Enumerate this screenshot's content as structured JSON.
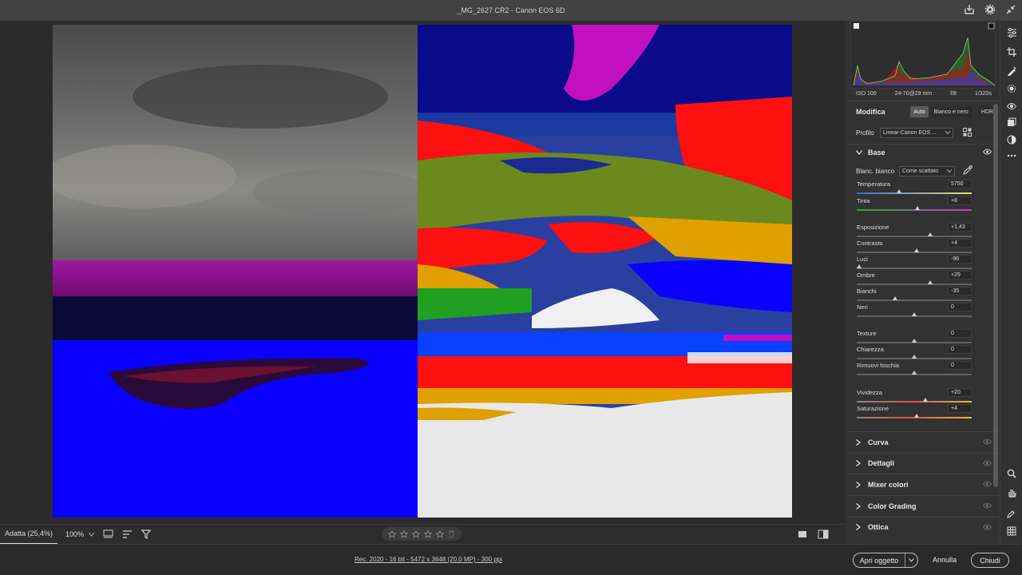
{
  "window": {
    "title": "_MG_2627.CR2  -  Canon EOS 6D"
  },
  "exif": {
    "iso": "ISO 100",
    "lens": "24-70@29 mm",
    "aperture": "f/8",
    "shutter": "1/320s"
  },
  "edit": {
    "title": "Modifica",
    "auto_label": "Auto",
    "bw_label": "Bianco e nero",
    "hdr_label": "HDR",
    "profile_label": "Profilo",
    "profile_value": "Linear-Canon EOS ..."
  },
  "base": {
    "title": "Base",
    "wb_label": "Blanc. bianco",
    "wb_value": "Come scattato",
    "sliders": [
      {
        "label": "Temperatura",
        "value": "5750",
        "pos": 0.37
      },
      {
        "label": "Tinta",
        "value": "+8",
        "pos": 0.53
      },
      {
        "label": "Esposizione",
        "value": "+1,43",
        "pos": 0.64
      },
      {
        "label": "Contrasto",
        "value": "+4",
        "pos": 0.52
      },
      {
        "label": "Luci",
        "value": "-96",
        "pos": 0.02
      },
      {
        "label": "Ombre",
        "value": "+29",
        "pos": 0.64
      },
      {
        "label": "Bianchi",
        "value": "-35",
        "pos": 0.33
      },
      {
        "label": "Neri",
        "value": "0",
        "pos": 0.5
      },
      {
        "label": "Texture",
        "value": "0",
        "pos": 0.5
      },
      {
        "label": "Chiarezza",
        "value": "0",
        "pos": 0.5
      },
      {
        "label": "Rimuovi foschia",
        "value": "0",
        "pos": 0.5
      },
      {
        "label": "Vividezza",
        "value": "+20",
        "pos": 0.6
      },
      {
        "label": "Saturazione",
        "value": "+4",
        "pos": 0.52
      }
    ]
  },
  "sections": [
    {
      "label": "Curva"
    },
    {
      "label": "Dettagli"
    },
    {
      "label": "Mixer colori"
    },
    {
      "label": "Color Grading"
    },
    {
      "label": "Ottica"
    }
  ],
  "toolbar": {
    "zoom_fit": "Adatta (25,4%)",
    "zoom_100": "100%"
  },
  "footer": {
    "info": "Rec. 2020 - 16 bit - 5472 x 3648 (20,0 MP) - 300 ppi",
    "open_label": "Apri oggetto",
    "cancel_label": "Annulla",
    "close_label": "Chiudi"
  },
  "colors": {
    "accent": "#dcdcdc",
    "panel": "#323232",
    "image_blue": "#0a00ff",
    "image_red": "#ff1010",
    "image_magenta": "#c010c0"
  },
  "icons": {
    "export": "export-icon",
    "settings": "gear-icon",
    "collapse": "collapse-icon"
  }
}
